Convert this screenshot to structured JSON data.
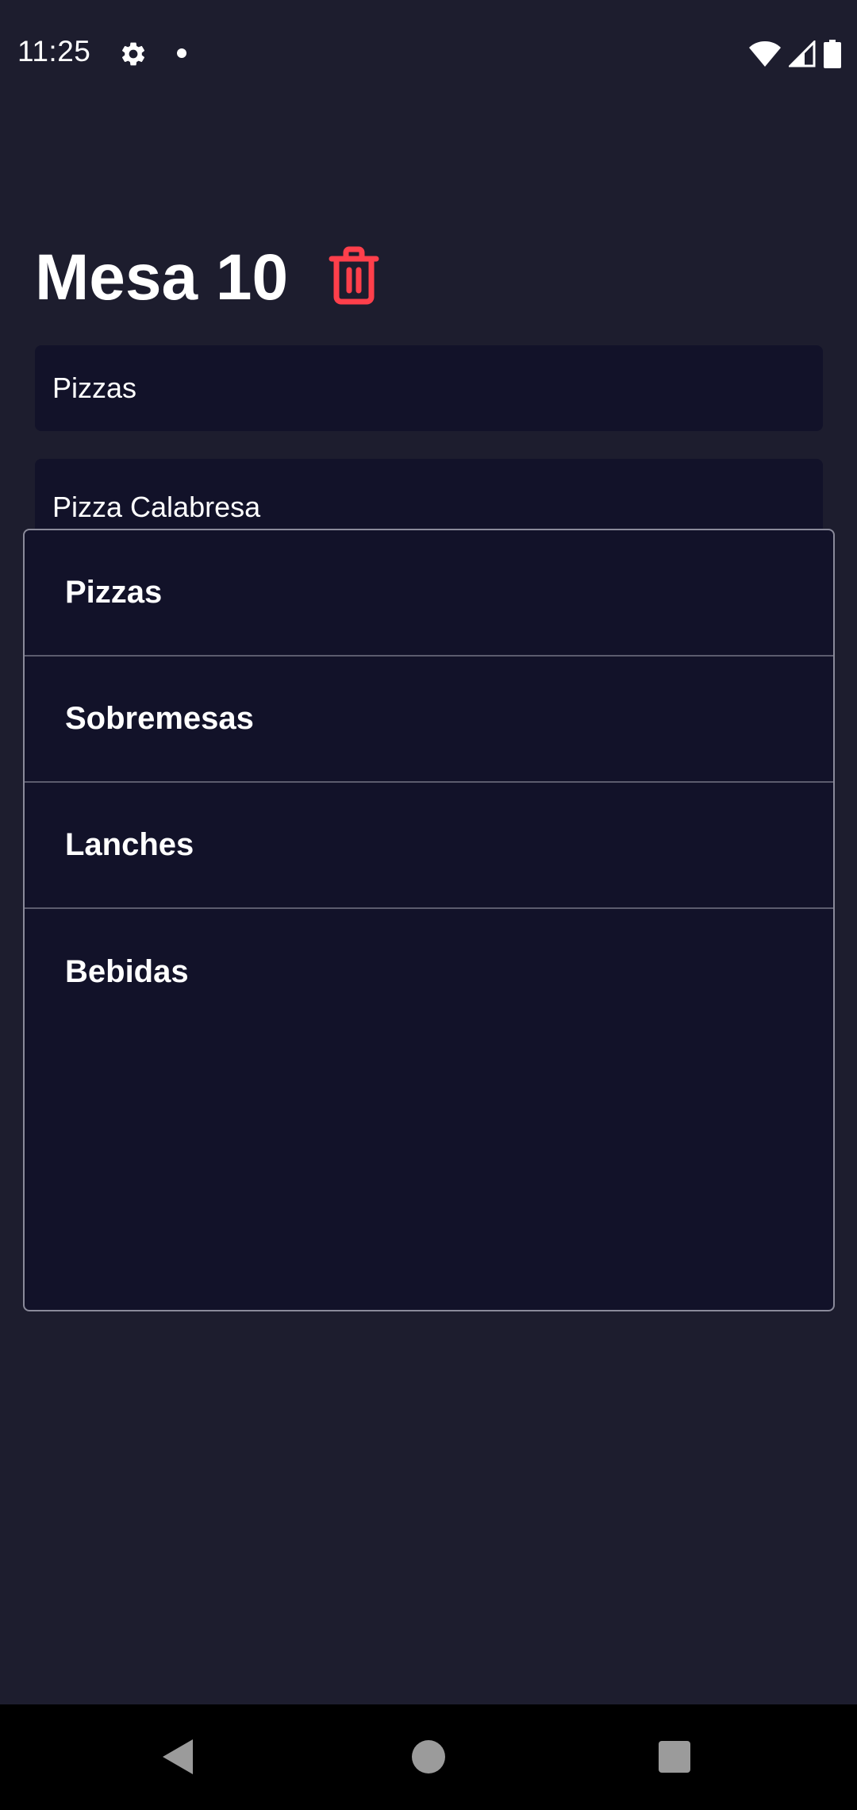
{
  "status_bar": {
    "time": "11:25",
    "icons": [
      "gear-icon",
      "notification-dot-icon",
      "wifi-icon",
      "signal-icon",
      "battery-icon"
    ]
  },
  "header": {
    "title": "Mesa 10",
    "delete_icon": "trash-icon"
  },
  "form": {
    "category_value": "Pizzas",
    "product_value": "Pizza Calabresa"
  },
  "dropdown": {
    "options": [
      {
        "label": "Pizzas"
      },
      {
        "label": "Sobremesas"
      },
      {
        "label": "Lanches"
      },
      {
        "label": "Bebidas"
      }
    ]
  },
  "colors": {
    "background": "#1d1d2e",
    "field_background": "#121229",
    "danger": "#ff3f4b",
    "text": "#ffffff"
  },
  "nav_bar": {
    "icons": [
      "back-icon",
      "home-icon",
      "recents-icon"
    ]
  }
}
